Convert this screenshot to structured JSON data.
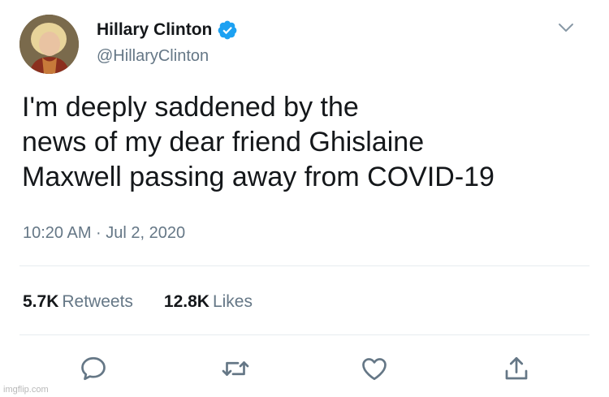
{
  "author": {
    "display_name": "Hillary Clinton",
    "handle": "@HillaryClinton",
    "verified": true,
    "avatar_icon": "profile-photo"
  },
  "tweet": {
    "lines": [
      "I'm deeply saddened by the",
      "news of my dear friend Ghislaine",
      "Maxwell passing away from COVID-19"
    ],
    "timestamp": "10:20 AM · Jul 2, 2020"
  },
  "stats": {
    "retweets_count": "5.7K",
    "retweets_label": "Retweets",
    "likes_count": "12.8K",
    "likes_label": "Likes"
  },
  "actions": {
    "reply_icon": "reply-icon",
    "retweet_icon": "retweet-icon",
    "like_icon": "heart-icon",
    "share_icon": "share-icon"
  },
  "watermark": "imgflip.com",
  "colors": {
    "text": "#14171a",
    "secondary": "#657786",
    "verified_blue": "#1da1f2",
    "divider": "#e6ecf0"
  }
}
